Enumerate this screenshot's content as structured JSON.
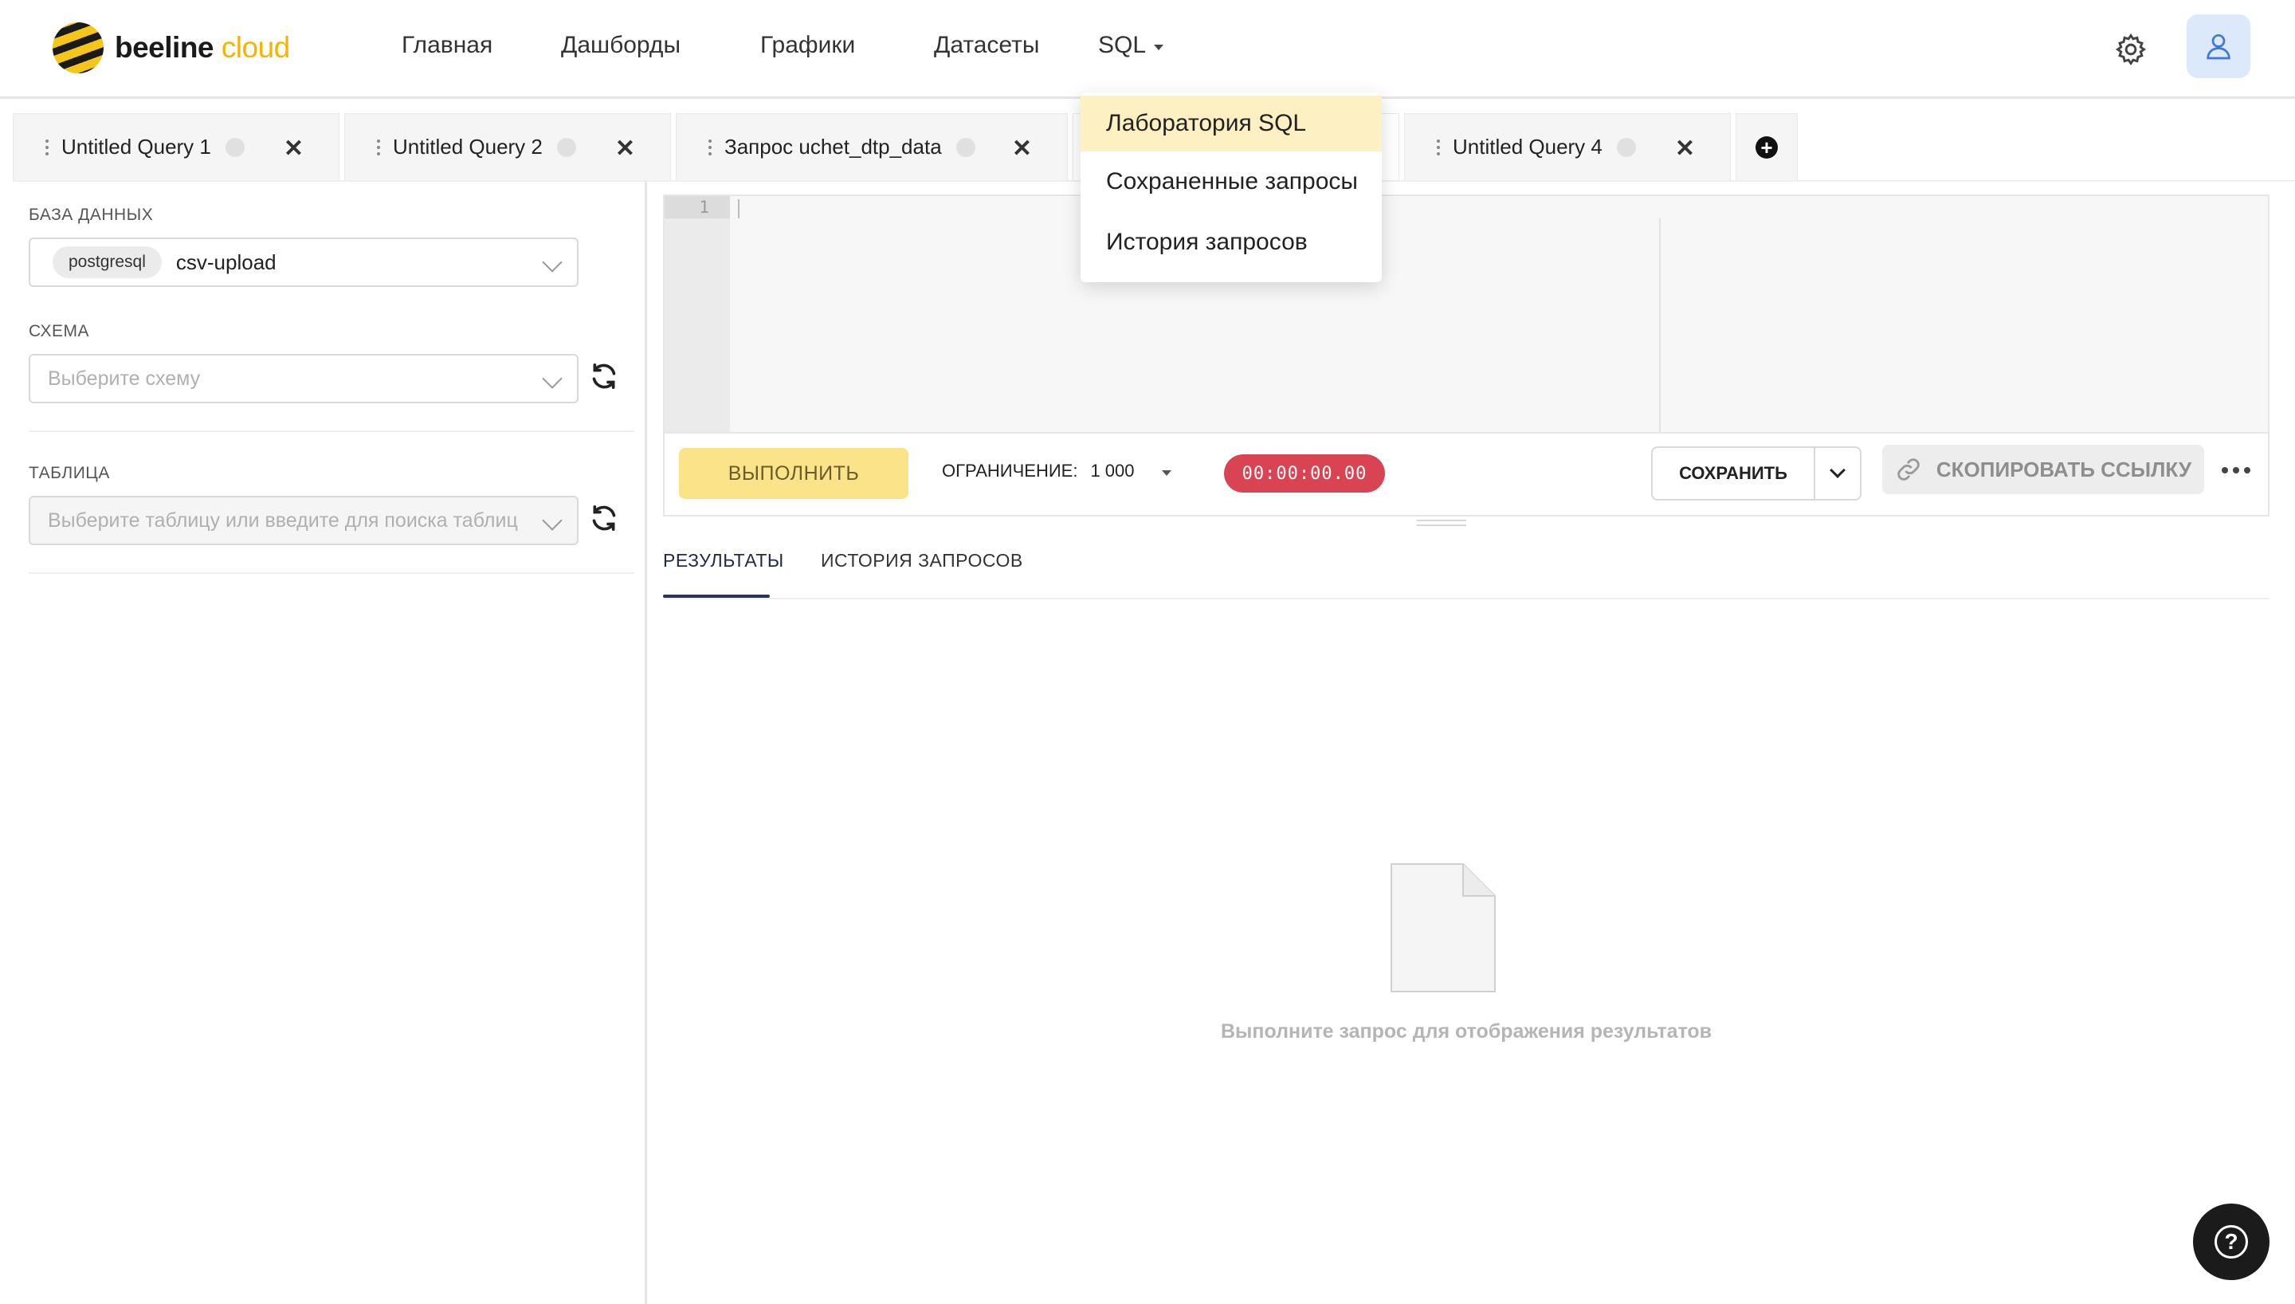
{
  "app": {
    "logo_word": "beeline",
    "logo_cloud": "cloud",
    "accent_color": "#f5c518"
  },
  "nav": {
    "items": [
      "Главная",
      "Дашборды",
      "Графики",
      "Датасеты"
    ],
    "sql_label": "SQL"
  },
  "sql_menu": {
    "items": [
      "Лаборатория SQL",
      "Сохраненные запросы",
      "История запросов"
    ],
    "active_index": 0
  },
  "tabs": [
    {
      "label": "Untitled Query 1"
    },
    {
      "label": "Untitled Query 2"
    },
    {
      "label": "Запрос uchet_dtp_data"
    },
    {
      "label": "Untitled Query 4"
    }
  ],
  "left": {
    "database_label": "БАЗА ДАННЫХ",
    "database_tag": "postgresql",
    "database_value": "csv-upload",
    "schema_label": "СХЕМА",
    "schema_placeholder": "Выберите схему",
    "table_label": "ТАБЛИЦА",
    "table_placeholder": "Выберите таблицу или введите для поиска таблиц"
  },
  "editor": {
    "line_number": "1",
    "run_label": "ВЫПОЛНИТЬ",
    "limit_label": "ОГРАНИЧЕНИЕ:",
    "limit_value": "1 000",
    "timer": "00:00:00.00",
    "timer_color": "#d94452",
    "save_label": "СОХРАНИТЬ",
    "copy_link_label": "СКОПИРОВАТЬ ССЫЛКУ"
  },
  "results": {
    "tab_results": "РЕЗУЛЬТАТЫ",
    "tab_history": "ИСТОРИЯ ЗАПРОСОВ",
    "empty_message": "Выполните запрос для отображения результатов"
  },
  "icons": {
    "settings": "gear-icon",
    "user": "user-icon",
    "help": "help-icon",
    "refresh": "refresh-icon",
    "link": "link-icon"
  }
}
